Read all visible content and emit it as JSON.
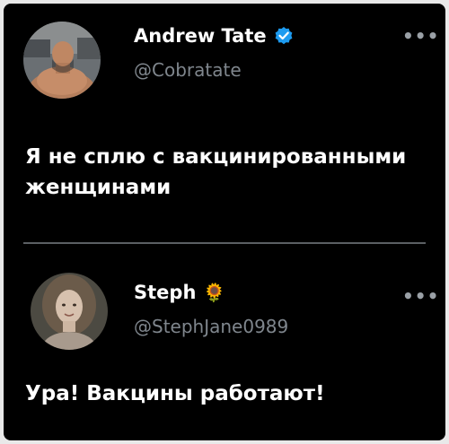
{
  "tweets": [
    {
      "name": "Andrew Tate",
      "handle": "@Cobratate",
      "verified": true,
      "text": "Я не сплю с вакцинированными женщинами",
      "more_label": "•••"
    },
    {
      "name": "Steph",
      "name_emoji": "🌻",
      "handle": "@StephJane0989",
      "text": "Ура! Вакцины работают!",
      "more_label": "•••"
    }
  ],
  "colors": {
    "background": "#000000",
    "outer": "#e9e9e9",
    "name": "#ffffff",
    "handle": "#7f868d",
    "verified": "#1d9bf0",
    "divider": "#5b5f63"
  },
  "icons": {
    "verified": "verified-badge-icon",
    "more": "more-options-icon",
    "sunflower": "sunflower-emoji-icon"
  }
}
